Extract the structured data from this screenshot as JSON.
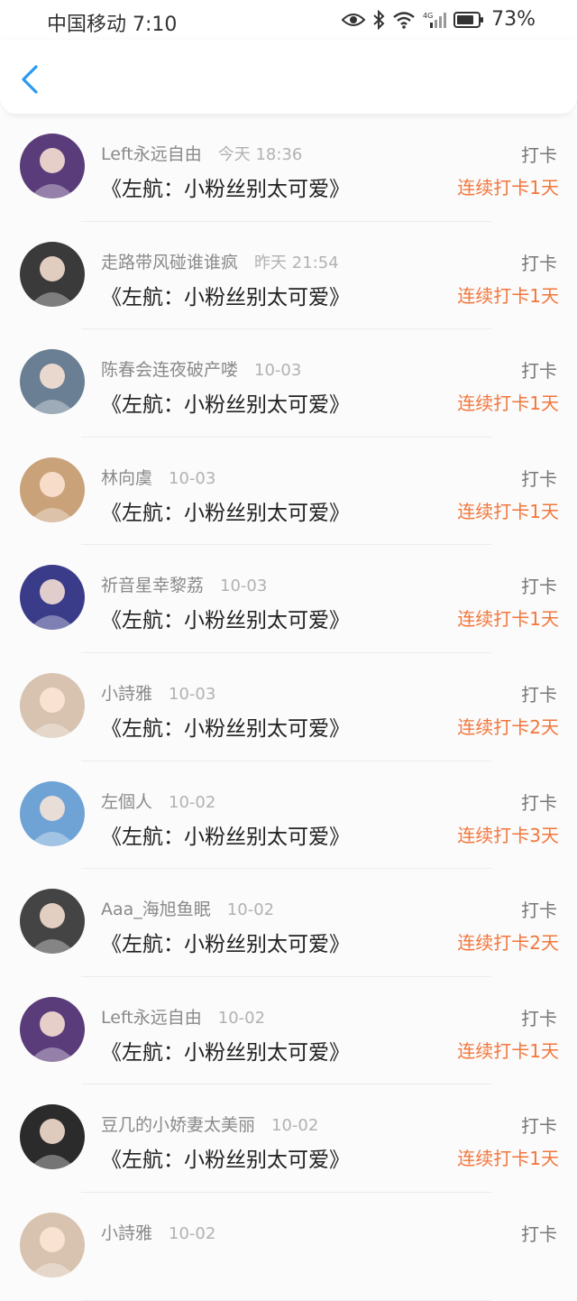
{
  "status_bar": {
    "carrier_time": "中国移动 7:10",
    "battery": "73%"
  },
  "items": [
    {
      "name": "Left永远自由",
      "time": "今天 18:36",
      "title": "《左航：小粉丝别太可爱》",
      "action": "打卡",
      "streak": "连续打卡1天",
      "avatar_color": "#5b3c7a"
    },
    {
      "name": "走路带风碰谁谁疯",
      "time": "昨天 21:54",
      "title": "《左航：小粉丝别太可爱》",
      "action": "打卡",
      "streak": "连续打卡1天",
      "avatar_color": "#3a3a3a"
    },
    {
      "name": "陈春会连夜破产喽",
      "time": "10-03",
      "title": "《左航：小粉丝别太可爱》",
      "action": "打卡",
      "streak": "连续打卡1天",
      "avatar_color": "#6a7f93"
    },
    {
      "name": "林向虞",
      "time": "10-03",
      "title": "《左航：小粉丝别太可爱》",
      "action": "打卡",
      "streak": "连续打卡1天",
      "avatar_color": "#c9a27a"
    },
    {
      "name": "祈音星幸黎荔",
      "time": "10-03",
      "title": "《左航：小粉丝别太可爱》",
      "action": "打卡",
      "streak": "连续打卡1天",
      "avatar_color": "#3a3c8a"
    },
    {
      "name": "小詩雅",
      "time": "10-03",
      "title": "《左航：小粉丝别太可爱》",
      "action": "打卡",
      "streak": "连续打卡2天",
      "avatar_color": "#d8c3b0"
    },
    {
      "name": "左個人",
      "time": "10-02",
      "title": "《左航：小粉丝别太可爱》",
      "action": "打卡",
      "streak": "连续打卡3天",
      "avatar_color": "#6fa3d6"
    },
    {
      "name": "Aaa_海旭鱼眠",
      "time": "10-02",
      "title": "《左航：小粉丝别太可爱》",
      "action": "打卡",
      "streak": "连续打卡2天",
      "avatar_color": "#444444"
    },
    {
      "name": "Left永远自由",
      "time": "10-02",
      "title": "《左航：小粉丝别太可爱》",
      "action": "打卡",
      "streak": "连续打卡1天",
      "avatar_color": "#5b3c7a"
    },
    {
      "name": "豆几的小娇妻太美丽",
      "time": "10-02",
      "title": "《左航：小粉丝别太可爱》",
      "action": "打卡",
      "streak": "连续打卡1天",
      "avatar_color": "#2b2b2b"
    },
    {
      "name": "小詩雅",
      "time": "10-02",
      "title": "",
      "action": "打卡",
      "streak": "",
      "avatar_color": "#d8c3b0"
    }
  ],
  "colors": {
    "accent_back": "#2a9af3",
    "streak": "#f2763b"
  }
}
